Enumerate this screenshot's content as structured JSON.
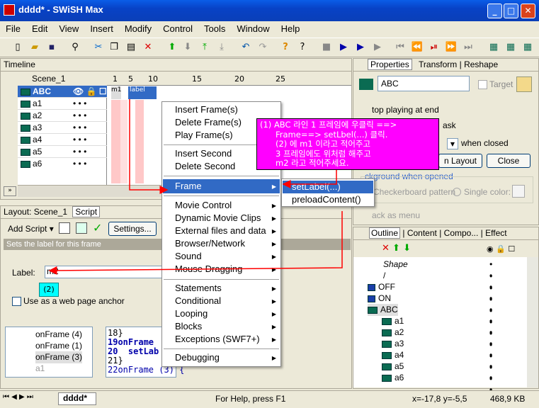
{
  "window": {
    "title": "dddd* - SWiSH Max"
  },
  "menubar": [
    "File",
    "Edit",
    "View",
    "Insert",
    "Modify",
    "Control",
    "Tools",
    "Window",
    "Help"
  ],
  "timeline": {
    "title": "Timeline",
    "scene": "Scene_1",
    "ruler": [
      "1",
      "5",
      "10",
      "15",
      "20",
      "25"
    ],
    "labels": [
      "m1",
      "label"
    ],
    "tracks": [
      "ABC",
      "a1",
      "a2",
      "a3",
      "a4",
      "a5",
      "a6"
    ]
  },
  "properties": {
    "tabs": [
      "Properties",
      "Transform",
      "Reshape"
    ],
    "name_value": "ABC",
    "target_label": "Target",
    "stop_text": "top playing at end",
    "ask_text": "ask",
    "when_closed": "when closed",
    "layout_btn": "n Layout",
    "close_btn": "Close",
    "bg_group": "ckground when opened",
    "checker": "Checkerboard pattern",
    "single": "Single color:",
    "track": "ack as menu"
  },
  "outline": {
    "tabs": [
      "Outline",
      "Content",
      "Compo...",
      "Effect"
    ],
    "items": [
      "Shape",
      "/",
      "OFF",
      "ON",
      "ABC",
      "a1",
      "a2",
      "a3",
      "a4",
      "a5",
      "a6"
    ]
  },
  "script": {
    "tabs": [
      "Layout: Scene_1",
      "Script"
    ],
    "add_script": "Add Script",
    "settings": "Settings...",
    "description": "Sets the label for this frame",
    "label_caption": "Label:",
    "label_value": "m2",
    "web_anchor": "Use as a web page anchor",
    "tag2": "(2)",
    "tree": [
      "onFrame (4)",
      "onFrame (1)",
      "onFrame (3)",
      "a1"
    ],
    "code_lines": [
      "18}",
      "19onFrame",
      "20  setLab",
      "21}",
      "22onFrame (3) {"
    ]
  },
  "context_menu": {
    "group1": [
      "Insert Frame(s)",
      "Delete Frame(s)",
      "Play Frame(s)"
    ],
    "group2": [
      "Insert Second",
      "Delete Second"
    ],
    "frame": "Frame",
    "group3": [
      "Movie Control",
      "Dynamic Movie Clips",
      "External files and data",
      "Browser/Network",
      "Sound",
      "Mouse Dragging"
    ],
    "group4": [
      "Statements",
      "Conditional",
      "Looping",
      "Blocks",
      "Exceptions (SWF7+)"
    ],
    "debugging": "Debugging"
  },
  "submenu": [
    "setLabel(...)",
    "preloadContent()"
  ],
  "annotation": [
    "(1) ABC 라인 1 프레임에 우클릭 ==>",
    "Frame==> setLbel(...) 클릭.",
    "(2) 에 m1 이라고 적어주고",
    "3 프레임에도 위처럼 해주고",
    "m2 라고 적어주세요."
  ],
  "status": {
    "tab": "dddd*",
    "help": "For Help, press F1",
    "coords": "x=-17,8 y=-5,5",
    "size": "468,9 KB"
  },
  "colors": {
    "highlight": "#316ac5",
    "note": "#ff00ff",
    "arrow": "#ff0000"
  }
}
